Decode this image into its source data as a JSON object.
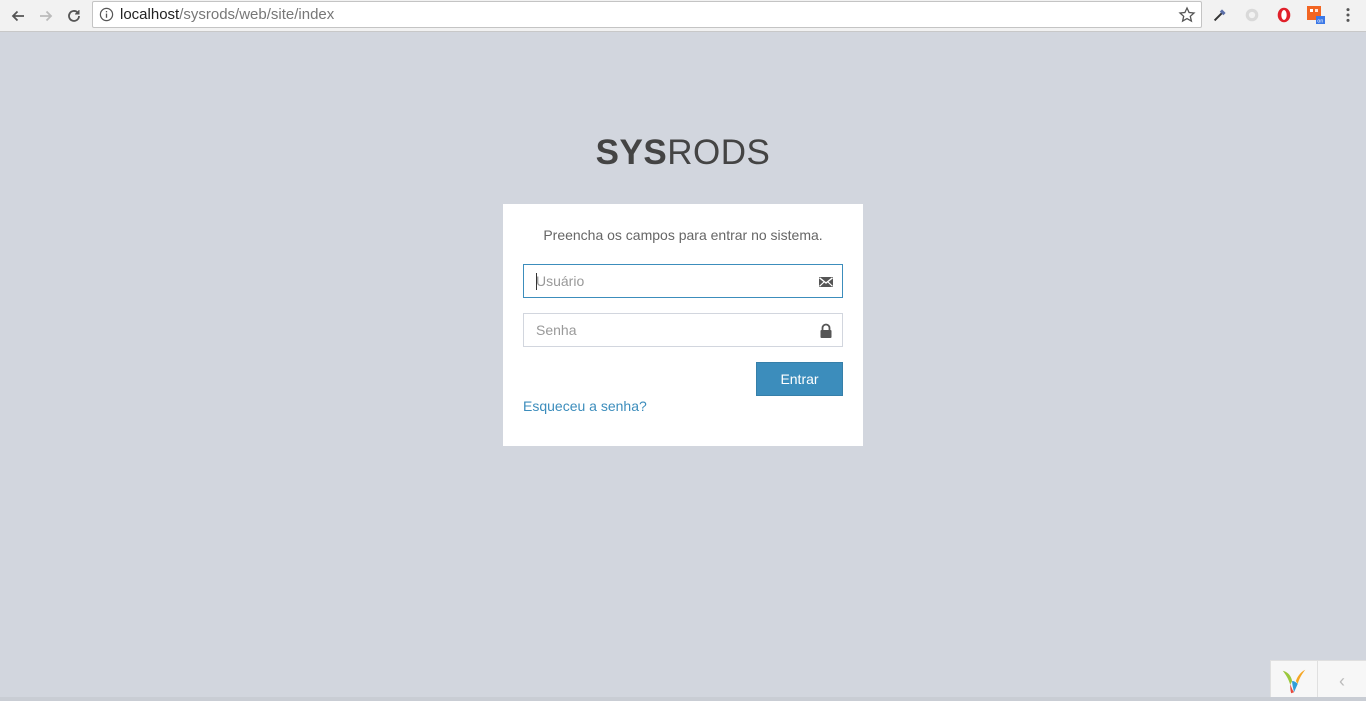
{
  "browser": {
    "url_host": "localhost",
    "url_path": "/sysrods/web/site/index"
  },
  "brand": {
    "bold": "SYS",
    "light": "RODS"
  },
  "login": {
    "message": "Preencha os campos para entrar no sistema.",
    "username_placeholder": "Usuário",
    "password_placeholder": "Senha",
    "submit_label": "Entrar",
    "forgot_label": "Esqueceu a senha?"
  },
  "debug_toolbar": {
    "toggle_glyph": "‹"
  },
  "colors": {
    "background": "#d2d6de",
    "primary": "#3c8dbc"
  },
  "icons": [
    "back-arrow-icon",
    "forward-arrow-icon",
    "reload-icon",
    "info-icon",
    "star-icon",
    "eyedropper-icon",
    "extension-icon",
    "opera-icon",
    "extension-on-icon",
    "menu-icon",
    "envelope-icon",
    "lock-icon",
    "yii-logo-icon"
  ]
}
